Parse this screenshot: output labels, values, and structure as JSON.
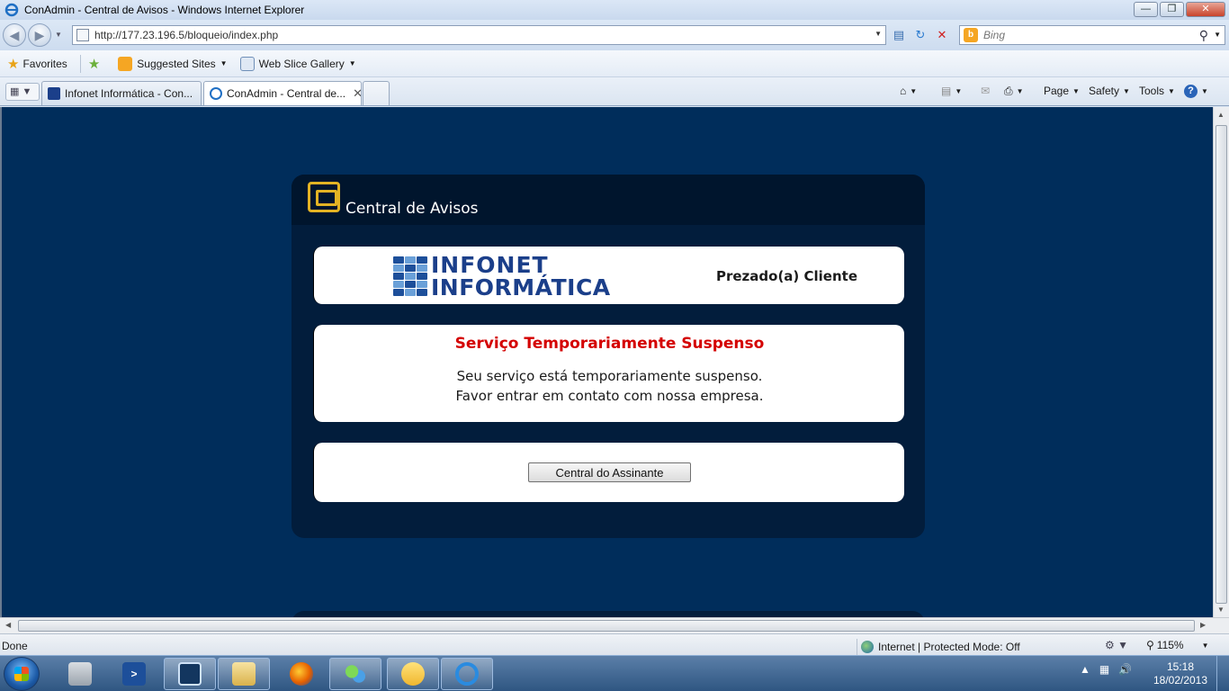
{
  "window": {
    "title": "ConAdmin - Central de Avisos - Windows Internet Explorer",
    "minimize_glyph": "—",
    "maximize_glyph": "❐",
    "close_glyph": "✕"
  },
  "address_bar": {
    "url": "http://177.23.196.5/bloqueio/index.php"
  },
  "search": {
    "provider": "Bing",
    "placeholder": "Bing"
  },
  "favorites_bar": {
    "favorites_label": "Favorites",
    "items": [
      {
        "label": "Suggested Sites"
      },
      {
        "label": "Web Slice Gallery"
      }
    ]
  },
  "tabs": [
    {
      "label": "Infonet Informática - Con...",
      "active": false
    },
    {
      "label": "ConAdmin - Central de...",
      "active": true
    }
  ],
  "command_bar": {
    "page_label": "Page",
    "safety_label": "Safety",
    "tools_label": "Tools",
    "help_label": "?"
  },
  "page": {
    "header_title": "Central de Avisos",
    "logo": {
      "line1": "INFONET",
      "line2": "INFORMÁTICA"
    },
    "greeting": "Prezado(a) Cliente",
    "notice_title": "Serviço Temporariamente Suspenso",
    "notice_line1": "Seu serviço está temporariamente suspenso.",
    "notice_line2": "Favor entrar em contato com nossa empresa.",
    "button_label": "Central do Assinante"
  },
  "status_bar": {
    "status": "Done",
    "zone": "Internet | Protected Mode: Off",
    "zoom": "115%"
  },
  "taskbar": {
    "time": "15:18",
    "date": "18/02/2013"
  },
  "colors": {
    "page_background": "#002d5b",
    "panel": "#021d3c",
    "notice_red": "#d40000",
    "logo_blue": "#1b3f8a",
    "accent_yellow": "#e4b324"
  }
}
